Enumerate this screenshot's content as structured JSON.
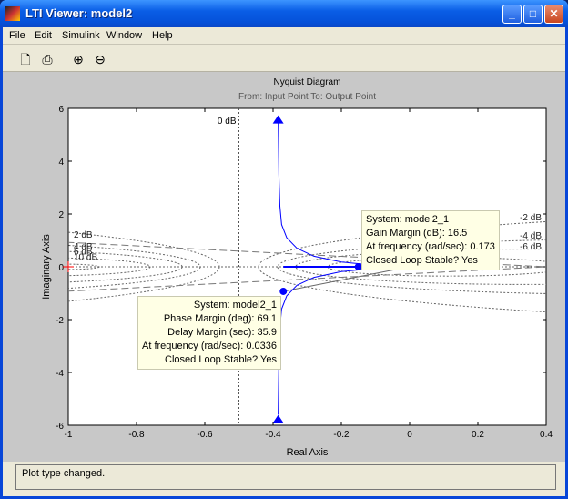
{
  "window": {
    "title": "LTI Viewer: model2"
  },
  "menu": [
    "File",
    "Edit",
    "Simulink",
    "Window",
    "Help"
  ],
  "toolbar": [
    "new-icon",
    "print-icon",
    "zoom-in-icon",
    "zoom-out-icon"
  ],
  "status": "Plot type changed.",
  "chart_data": {
    "type": "line",
    "title": "Nyquist Diagram",
    "subtitle": "From: Input Point  To: Output Point",
    "xlabel": "Real Axis",
    "ylabel": "Imaginary Axis",
    "xlim": [
      -1,
      0.4
    ],
    "ylim": [
      -6,
      6
    ],
    "xticks": [
      -1,
      -0.8,
      -0.6,
      -0.4,
      -0.2,
      0,
      0.2,
      0.4
    ],
    "xtick_labels": [
      "-1",
      "-0.8",
      "-0.6",
      "-0.4",
      "-0.2",
      "0",
      "0.2",
      "0.4"
    ],
    "yticks": [
      6,
      4,
      2,
      0,
      -2,
      -4,
      -6
    ],
    "ytick_labels": [
      "6",
      "4",
      "2",
      "0",
      "-2",
      "-4",
      "-6"
    ],
    "grid_db": [
      0,
      2,
      4,
      6,
      10,
      20,
      -2,
      -4,
      -6,
      -10,
      -20
    ],
    "grid_labels": [
      "0 dB",
      "2 dB",
      "4 dB",
      "6 dB",
      "10 dB",
      "-2 dB",
      "-4 dB",
      "-6 dB"
    ],
    "series_color": "#0000ff",
    "curve": [
      [
        -0.385,
        5.6
      ],
      [
        -0.383,
        3.5
      ],
      [
        -0.38,
        2.3
      ],
      [
        -0.375,
        1.6
      ],
      [
        -0.36,
        1.1
      ],
      [
        -0.33,
        0.7
      ],
      [
        -0.28,
        0.4
      ],
      [
        -0.2,
        0.18
      ],
      [
        -0.1,
        0.06
      ],
      [
        0.02,
        0
      ]
    ],
    "gain_margin": {
      "point": [
        -0.15,
        0
      ],
      "lines": [
        "System: model2_1",
        "Gain Margin (dB): 16.5",
        "At frequency (rad/sec): 0.173",
        "Closed Loop Stable? Yes"
      ]
    },
    "phase_margin": {
      "point": [
        -0.37,
        -0.93
      ],
      "lines": [
        "System: model2_1",
        "Phase Margin (deg): 69.1",
        "Delay Margin (sec): 35.9",
        "At frequency (rad/sec): 0.0336",
        "Closed Loop Stable? Yes"
      ]
    }
  }
}
